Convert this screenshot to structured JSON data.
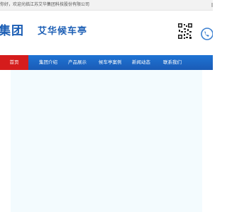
{
  "topbar": {
    "welcome": "你好，欢迎光临江苏艾华集团科技股份有限公司"
  },
  "header": {
    "logo_group": "集团",
    "logo_brand": "艾华候车亭"
  },
  "nav": {
    "items": [
      {
        "label": "首页"
      },
      {
        "label": "集团介绍"
      },
      {
        "label": "产品展示"
      },
      {
        "label": "候车亭案例"
      },
      {
        "label": "新闻动态"
      },
      {
        "label": "联系我们"
      }
    ]
  },
  "colors": {
    "brand": "#1d5fb5",
    "nav_bar": "#1f6fcf",
    "nav_active": "#d51c1c",
    "content_band": "#f3fbfe"
  },
  "icons": [
    "qr-code-icon",
    "phone-icon"
  ]
}
